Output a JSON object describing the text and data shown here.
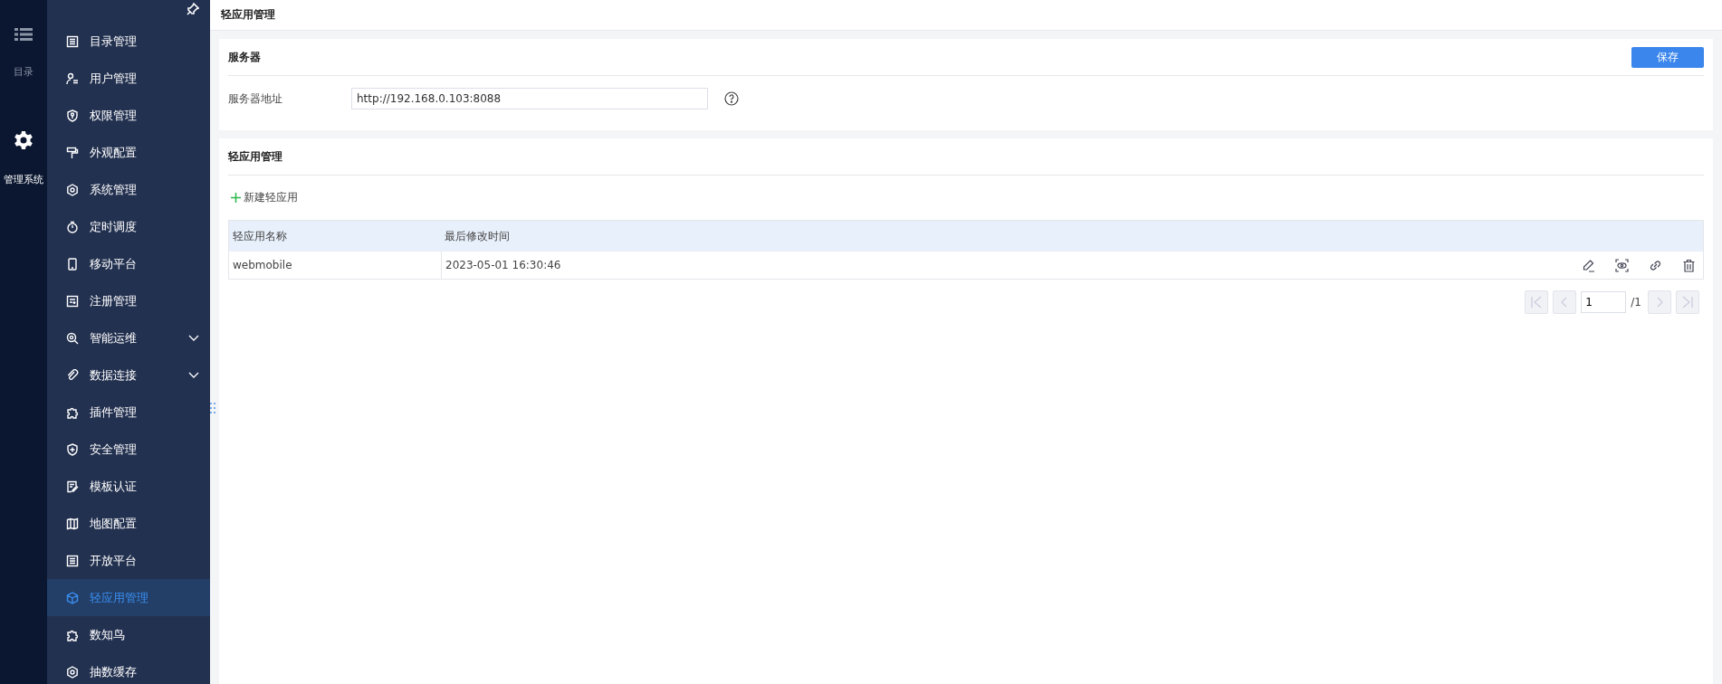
{
  "rail": {
    "items": [
      {
        "label": "目录",
        "kind": "list",
        "selected": false
      },
      {
        "label": "管理系统",
        "kind": "gear",
        "selected": true
      }
    ]
  },
  "sidebar": {
    "items": [
      {
        "label": "目录管理",
        "kind": "list",
        "expandable": false,
        "selected": false
      },
      {
        "label": "用户管理",
        "kind": "user",
        "expandable": false,
        "selected": false
      },
      {
        "label": "权限管理",
        "kind": "shield-key",
        "expandable": false,
        "selected": false
      },
      {
        "label": "外观配置",
        "kind": "roller",
        "expandable": false,
        "selected": false
      },
      {
        "label": "系统管理",
        "kind": "gear",
        "expandable": false,
        "selected": false
      },
      {
        "label": "定时调度",
        "kind": "timer",
        "expandable": false,
        "selected": false
      },
      {
        "label": "移动平台",
        "kind": "phone",
        "expandable": false,
        "selected": false
      },
      {
        "label": "注册管理",
        "kind": "form",
        "expandable": false,
        "selected": false
      },
      {
        "label": "智能运维",
        "kind": "search-gear",
        "expandable": true,
        "selected": false
      },
      {
        "label": "数据连接",
        "kind": "clip",
        "expandable": true,
        "selected": false
      },
      {
        "label": "插件管理",
        "kind": "puzzle",
        "expandable": false,
        "selected": false
      },
      {
        "label": "安全管理",
        "kind": "shield",
        "expandable": false,
        "selected": false
      },
      {
        "label": "模板认证",
        "kind": "edit",
        "expandable": false,
        "selected": false
      },
      {
        "label": "地图配置",
        "kind": "map",
        "expandable": false,
        "selected": false
      },
      {
        "label": "开放平台",
        "kind": "list",
        "expandable": false,
        "selected": false
      },
      {
        "label": "轻应用管理",
        "kind": "cube",
        "expandable": false,
        "selected": true
      },
      {
        "label": "数知鸟",
        "kind": "puzzle",
        "expandable": false,
        "selected": false
      },
      {
        "label": "抽数缓存",
        "kind": "gear",
        "expandable": false,
        "selected": false
      }
    ]
  },
  "header": {
    "title": "轻应用管理"
  },
  "server": {
    "title": "服务器",
    "save": "保存",
    "label": "服务器地址",
    "value": "http://192.168.0.103:8088"
  },
  "apps": {
    "title": "轻应用管理",
    "add": "新建轻应用",
    "table": {
      "columns": [
        "轻应用名称",
        "最后修改时间"
      ],
      "rows": [
        {
          "name": "webmobile",
          "modified": "2023-05-01 16:30:46"
        }
      ]
    },
    "pagination": {
      "page": "1",
      "total": "/1"
    }
  }
}
